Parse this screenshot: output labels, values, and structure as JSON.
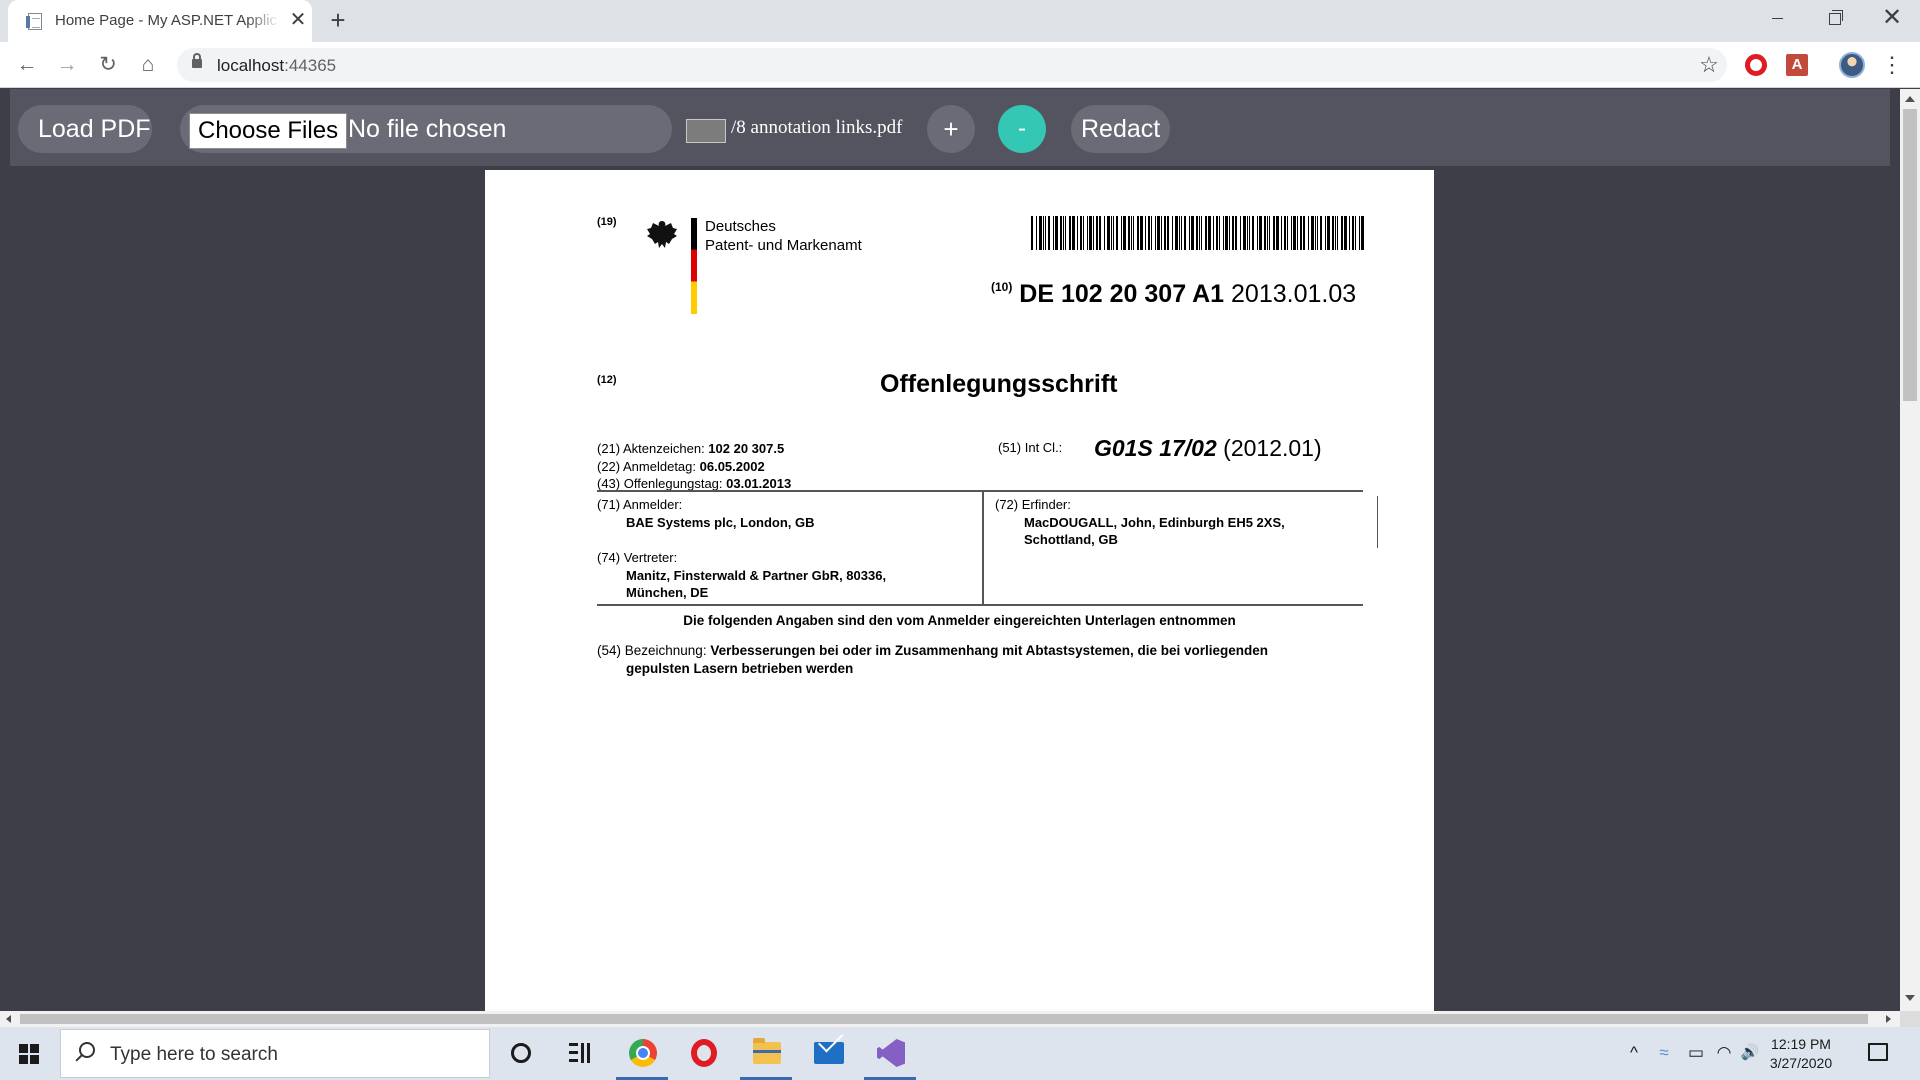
{
  "browser": {
    "tab_title": "Home Page - My ASP.NET Applic",
    "tab_close": "✕",
    "new_tab": "+",
    "back": "←",
    "forward": "→",
    "reload": "↻",
    "home": "⌂",
    "url_host": "localhost",
    "url_port": ":44365",
    "bookmark_star": "☆",
    "menu": "⋮",
    "window_close": "✕",
    "pdf_ext_label": "A"
  },
  "app": {
    "load_pdf_label": "Load PDF",
    "choose_files_label": "Choose Files",
    "no_file_label": "No file chosen",
    "page_total_label": "/8 annotation links.pdf",
    "zoom_in_label": "+",
    "zoom_out_label": "-",
    "redact_label": "Redact",
    "accent_color": "#34c8b4"
  },
  "pdf": {
    "tag19": "(19)",
    "office_line1": "Deutsches",
    "office_line2": "Patent- und Markenamt",
    "tag10": "(10)",
    "doc_number": "DE 102 20 307 A1",
    "doc_date": "2013.01.03",
    "tag12": "(12)",
    "doc_type": "Offenlegungsschrift",
    "meta": [
      {
        "label": "(21) Aktenzeichen: ",
        "value": "102 20 307.5"
      },
      {
        "label": "(22) Anmeldetag: ",
        "value": "06.05.2002"
      },
      {
        "label": "(43) Offenlegungstag: ",
        "value": "03.01.2013"
      }
    ],
    "int_cl_label": "(51) Int Cl.:",
    "int_cl_code": "G01S 17/02",
    "int_cl_year": "(2012.01)",
    "applicant_label": "(71) Anmelder:",
    "applicant_name": "BAE Systems plc, London, GB",
    "representative_label": "(74) Vertreter:",
    "representative_line1": "Manitz, Finsterwald & Partner GbR, 80336,",
    "representative_line2": "München, DE",
    "inventor_label": "(72) Erfinder:",
    "inventor_line1": "MacDOUGALL, John, Edinburgh EH5 2XS,",
    "inventor_line2": "Schottland, GB",
    "notice": "Die folgenden Angaben sind den vom Anmelder eingereichten Unterlagen entnommen",
    "title_label": "(54) Bezeichnung: ",
    "title_line1": "Verbesserungen bei oder im Zusammenhang mit Abtastsystemen, die bei vorliegenden",
    "title_line2": "gepulsten Lasern betrieben werden"
  },
  "taskbar": {
    "search_placeholder": "Type here to search",
    "time": "12:19 PM",
    "date": "3/27/2020",
    "tray_chevron": "^",
    "tray_volume": "🔊"
  }
}
